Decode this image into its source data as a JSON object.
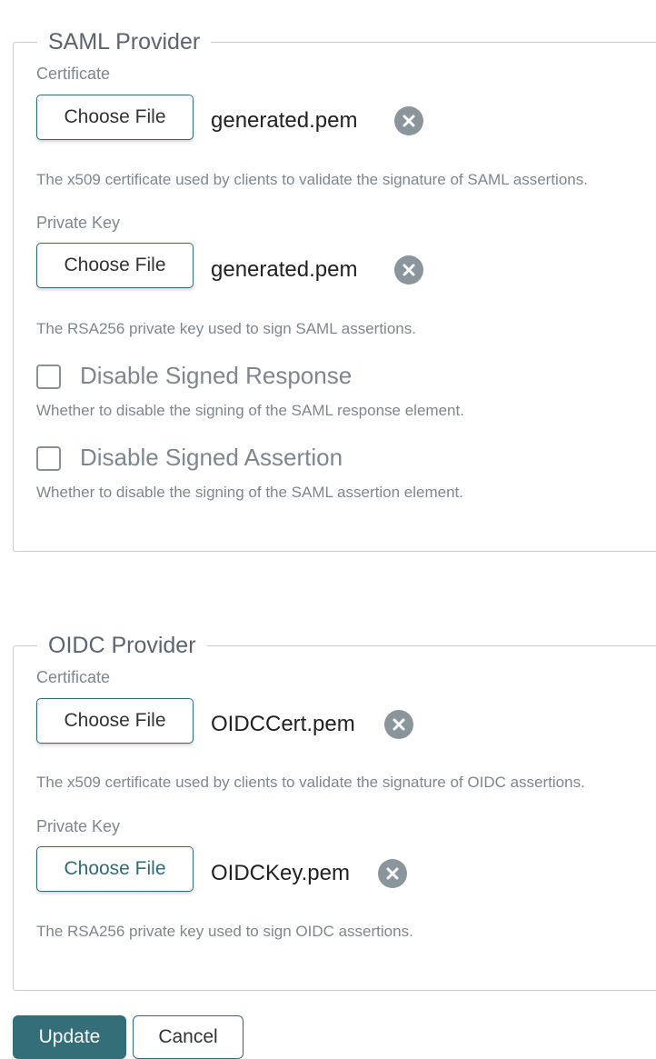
{
  "saml": {
    "legend": "SAML Provider",
    "certificate": {
      "label": "Certificate",
      "button": "Choose File",
      "filename": "generated.pem",
      "help": "The x509 certificate used by clients to validate the signature of SAML assertions."
    },
    "private_key": {
      "label": "Private Key",
      "button": "Choose File",
      "filename": "generated.pem",
      "help": "The RSA256 private key used to sign SAML assertions."
    },
    "disable_signed_response": {
      "label": "Disable Signed Response",
      "checked": false,
      "help": "Whether to disable the signing of the SAML response element."
    },
    "disable_signed_assertion": {
      "label": "Disable Signed Assertion",
      "checked": false,
      "help": "Whether to disable the signing of the SAML assertion element."
    }
  },
  "oidc": {
    "legend": "OIDC Provider",
    "certificate": {
      "label": "Certificate",
      "button": "Choose File",
      "filename": "OIDCCert.pem",
      "help": "The x509 certificate used by clients to validate the signature of OIDC assertions."
    },
    "private_key": {
      "label": "Private Key",
      "button": "Choose File",
      "filename": "OIDCKey.pem",
      "help": "The RSA256 private key used to sign OIDC assertions."
    }
  },
  "actions": {
    "update": "Update",
    "cancel": "Cancel"
  },
  "colors": {
    "accent": "#346e79",
    "clear_icon": "#8b959c",
    "muted_text": "#7d8790"
  }
}
